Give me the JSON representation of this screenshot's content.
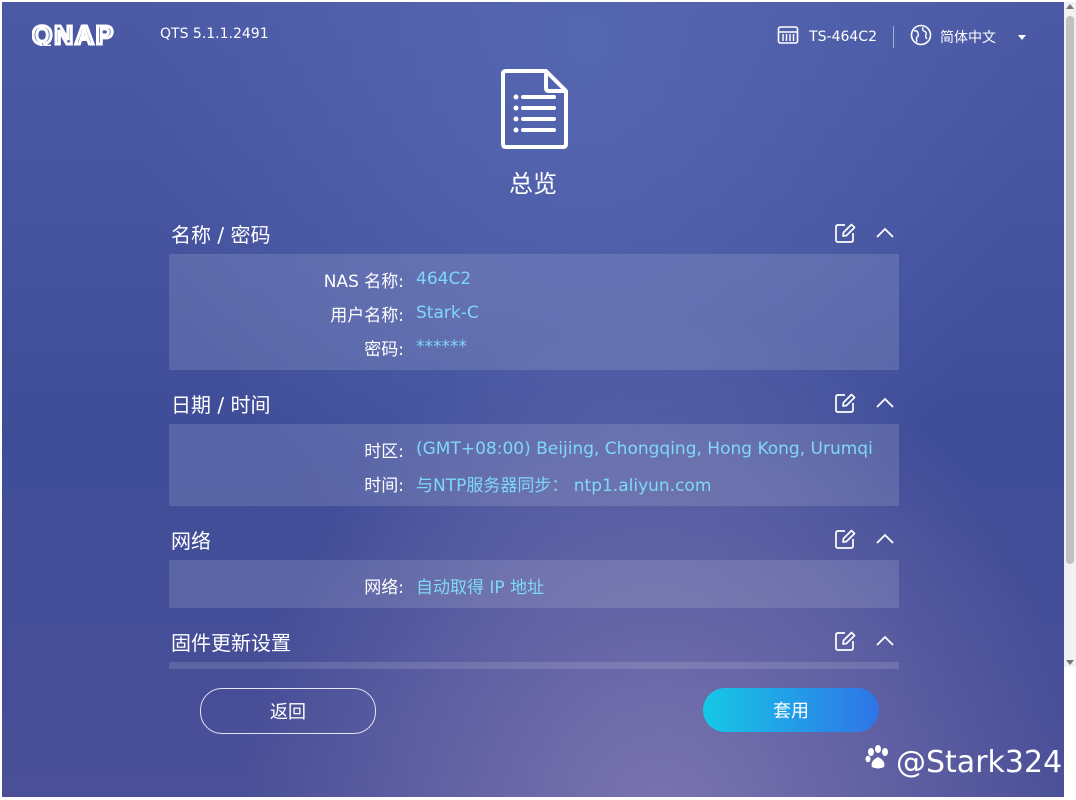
{
  "header": {
    "logo_text": "QNAP",
    "version": "QTS 5.1.1.2491",
    "device_name": "TS-464C2",
    "language": "简体中文"
  },
  "page": {
    "title": "总览"
  },
  "sections": [
    {
      "title": "名称 / 密码",
      "rows": [
        {
          "label": "NAS 名称:",
          "value": "464C2"
        },
        {
          "label": "用户名称:",
          "value": "Stark-C"
        },
        {
          "label": "密码:",
          "value": "******"
        }
      ]
    },
    {
      "title": "日期 / 时间",
      "rows": [
        {
          "label": "时区:",
          "value": "(GMT+08:00) Beijing, Chongqing, Hong Kong, Urumqi"
        },
        {
          "label": "时间:",
          "value": "与NTP服务器同步： ntp1.aliyun.com"
        }
      ]
    },
    {
      "title": "网络",
      "rows": [
        {
          "label": "网络:",
          "value": "自动取得 IP 地址"
        }
      ]
    },
    {
      "title": "固件更新设置",
      "rows": []
    }
  ],
  "footer": {
    "back_label": "返回",
    "apply_label": "套用"
  },
  "watermark": "@Stark324",
  "colors": {
    "value_text": "#7fd8f6",
    "apply_start": "#16c8e6",
    "apply_end": "#2f74e8"
  }
}
